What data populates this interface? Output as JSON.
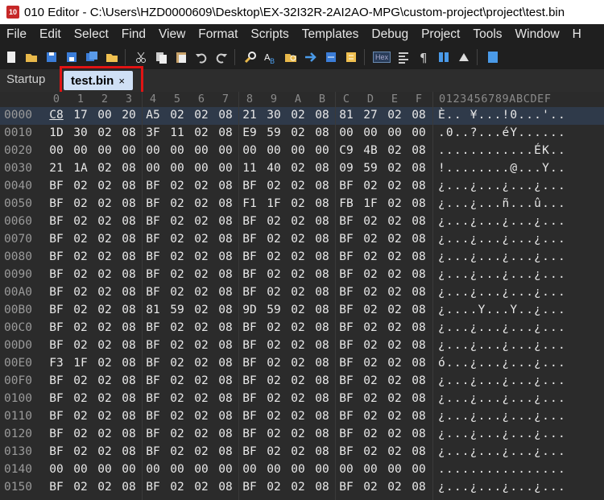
{
  "window": {
    "title": "010 Editor - C:\\Users\\HZD0000609\\Desktop\\EX-32I32R-2AI2AO-MPG\\custom-project\\project\\test.bin"
  },
  "menu": [
    "File",
    "Edit",
    "Select",
    "Find",
    "View",
    "Format",
    "Scripts",
    "Templates",
    "Debug",
    "Project",
    "Tools",
    "Window",
    "H"
  ],
  "toolbar": {
    "icons": [
      "new-file-icon",
      "open-folder-icon",
      "save-icon",
      "save-as-icon",
      "save-all-icon",
      "open-folder-2-icon",
      "cut-icon",
      "copy-icon",
      "paste-icon",
      "undo-icon",
      "redo-icon",
      "find-icon",
      "replace-icon",
      "find-in-files-icon",
      "goto-icon",
      "compare-icon",
      "inspector-icon",
      "hex-mode-icon",
      "columns-icon",
      "paragraph-icon",
      "list-icon",
      "highlight-icon",
      "calculator-icon"
    ],
    "hex_label": "Hex"
  },
  "tabs": {
    "startup": "Startup",
    "active": "test.bin",
    "close": "×"
  },
  "hex_header": {
    "columns": [
      "0",
      "1",
      "2",
      "3",
      "4",
      "5",
      "6",
      "7",
      "8",
      "9",
      "A",
      "B",
      "C",
      "D",
      "E",
      "F"
    ],
    "ascii": "0123456789ABCDEF"
  },
  "rows": [
    {
      "offset": "0000",
      "bytes": [
        "C8",
        "17",
        "00",
        "20",
        "A5",
        "02",
        "02",
        "08",
        "21",
        "30",
        "02",
        "08",
        "81",
        "27",
        "02",
        "08"
      ],
      "ascii": "È.. ¥...!0...'.."
    },
    {
      "offset": "0010",
      "bytes": [
        "1D",
        "30",
        "02",
        "08",
        "3F",
        "11",
        "02",
        "08",
        "E9",
        "59",
        "02",
        "08",
        "00",
        "00",
        "00",
        "00"
      ],
      "ascii": ".0..?...éY......"
    },
    {
      "offset": "0020",
      "bytes": [
        "00",
        "00",
        "00",
        "00",
        "00",
        "00",
        "00",
        "00",
        "00",
        "00",
        "00",
        "00",
        "C9",
        "4B",
        "02",
        "08"
      ],
      "ascii": "............ÉK.."
    },
    {
      "offset": "0030",
      "bytes": [
        "21",
        "1A",
        "02",
        "08",
        "00",
        "00",
        "00",
        "00",
        "11",
        "40",
        "02",
        "08",
        "09",
        "59",
        "02",
        "08"
      ],
      "ascii": "!........@...Y.."
    },
    {
      "offset": "0040",
      "bytes": [
        "BF",
        "02",
        "02",
        "08",
        "BF",
        "02",
        "02",
        "08",
        "BF",
        "02",
        "02",
        "08",
        "BF",
        "02",
        "02",
        "08"
      ],
      "ascii": "¿...¿...¿...¿..."
    },
    {
      "offset": "0050",
      "bytes": [
        "BF",
        "02",
        "02",
        "08",
        "BF",
        "02",
        "02",
        "08",
        "F1",
        "1F",
        "02",
        "08",
        "FB",
        "1F",
        "02",
        "08"
      ],
      "ascii": "¿...¿...ñ...û..."
    },
    {
      "offset": "0060",
      "bytes": [
        "BF",
        "02",
        "02",
        "08",
        "BF",
        "02",
        "02",
        "08",
        "BF",
        "02",
        "02",
        "08",
        "BF",
        "02",
        "02",
        "08"
      ],
      "ascii": "¿...¿...¿...¿..."
    },
    {
      "offset": "0070",
      "bytes": [
        "BF",
        "02",
        "02",
        "08",
        "BF",
        "02",
        "02",
        "08",
        "BF",
        "02",
        "02",
        "08",
        "BF",
        "02",
        "02",
        "08"
      ],
      "ascii": "¿...¿...¿...¿..."
    },
    {
      "offset": "0080",
      "bytes": [
        "BF",
        "02",
        "02",
        "08",
        "BF",
        "02",
        "02",
        "08",
        "BF",
        "02",
        "02",
        "08",
        "BF",
        "02",
        "02",
        "08"
      ],
      "ascii": "¿...¿...¿...¿..."
    },
    {
      "offset": "0090",
      "bytes": [
        "BF",
        "02",
        "02",
        "08",
        "BF",
        "02",
        "02",
        "08",
        "BF",
        "02",
        "02",
        "08",
        "BF",
        "02",
        "02",
        "08"
      ],
      "ascii": "¿...¿...¿...¿..."
    },
    {
      "offset": "00A0",
      "bytes": [
        "BF",
        "02",
        "02",
        "08",
        "BF",
        "02",
        "02",
        "08",
        "BF",
        "02",
        "02",
        "08",
        "BF",
        "02",
        "02",
        "08"
      ],
      "ascii": "¿...¿...¿...¿..."
    },
    {
      "offset": "00B0",
      "bytes": [
        "BF",
        "02",
        "02",
        "08",
        "81",
        "59",
        "02",
        "08",
        "9D",
        "59",
        "02",
        "08",
        "BF",
        "02",
        "02",
        "08"
      ],
      "ascii": "¿....Y...Y..¿..."
    },
    {
      "offset": "00C0",
      "bytes": [
        "BF",
        "02",
        "02",
        "08",
        "BF",
        "02",
        "02",
        "08",
        "BF",
        "02",
        "02",
        "08",
        "BF",
        "02",
        "02",
        "08"
      ],
      "ascii": "¿...¿...¿...¿..."
    },
    {
      "offset": "00D0",
      "bytes": [
        "BF",
        "02",
        "02",
        "08",
        "BF",
        "02",
        "02",
        "08",
        "BF",
        "02",
        "02",
        "08",
        "BF",
        "02",
        "02",
        "08"
      ],
      "ascii": "¿...¿...¿...¿..."
    },
    {
      "offset": "00E0",
      "bytes": [
        "F3",
        "1F",
        "02",
        "08",
        "BF",
        "02",
        "02",
        "08",
        "BF",
        "02",
        "02",
        "08",
        "BF",
        "02",
        "02",
        "08"
      ],
      "ascii": "ó...¿...¿...¿..."
    },
    {
      "offset": "00F0",
      "bytes": [
        "BF",
        "02",
        "02",
        "08",
        "BF",
        "02",
        "02",
        "08",
        "BF",
        "02",
        "02",
        "08",
        "BF",
        "02",
        "02",
        "08"
      ],
      "ascii": "¿...¿...¿...¿..."
    },
    {
      "offset": "0100",
      "bytes": [
        "BF",
        "02",
        "02",
        "08",
        "BF",
        "02",
        "02",
        "08",
        "BF",
        "02",
        "02",
        "08",
        "BF",
        "02",
        "02",
        "08"
      ],
      "ascii": "¿...¿...¿...¿..."
    },
    {
      "offset": "0110",
      "bytes": [
        "BF",
        "02",
        "02",
        "08",
        "BF",
        "02",
        "02",
        "08",
        "BF",
        "02",
        "02",
        "08",
        "BF",
        "02",
        "02",
        "08"
      ],
      "ascii": "¿...¿...¿...¿..."
    },
    {
      "offset": "0120",
      "bytes": [
        "BF",
        "02",
        "02",
        "08",
        "BF",
        "02",
        "02",
        "08",
        "BF",
        "02",
        "02",
        "08",
        "BF",
        "02",
        "02",
        "08"
      ],
      "ascii": "¿...¿...¿...¿..."
    },
    {
      "offset": "0130",
      "bytes": [
        "BF",
        "02",
        "02",
        "08",
        "BF",
        "02",
        "02",
        "08",
        "BF",
        "02",
        "02",
        "08",
        "BF",
        "02",
        "02",
        "08"
      ],
      "ascii": "¿...¿...¿...¿..."
    },
    {
      "offset": "0140",
      "bytes": [
        "00",
        "00",
        "00",
        "00",
        "00",
        "00",
        "00",
        "00",
        "00",
        "00",
        "00",
        "00",
        "00",
        "00",
        "00",
        "00"
      ],
      "ascii": "................"
    },
    {
      "offset": "0150",
      "bytes": [
        "BF",
        "02",
        "02",
        "08",
        "BF",
        "02",
        "02",
        "08",
        "BF",
        "02",
        "02",
        "08",
        "BF",
        "02",
        "02",
        "08"
      ],
      "ascii": "¿...¿...¿...¿..."
    }
  ]
}
